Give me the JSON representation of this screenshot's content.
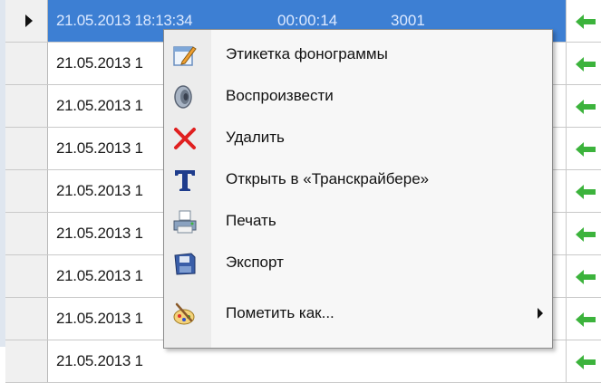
{
  "rows": [
    {
      "date": "21.05.2013 18:13:34",
      "duration": "00:00:14",
      "number": "3001",
      "selected": true
    },
    {
      "date": "21.05.2013 1"
    },
    {
      "date": "21.05.2013 1"
    },
    {
      "date": "21.05.2013 1"
    },
    {
      "date": "21.05.2013 1"
    },
    {
      "date": "21.05.2013 1"
    },
    {
      "date": "21.05.2013 1"
    },
    {
      "date": "21.05.2013 1"
    },
    {
      "date": "21.05.2013 1"
    }
  ],
  "context_menu": {
    "items": [
      {
        "label": "Этикетка фонограммы",
        "icon": "label-edit-icon"
      },
      {
        "label": "Воспроизвести",
        "icon": "speaker-icon"
      },
      {
        "label": "Удалить",
        "icon": "delete-x-icon"
      },
      {
        "label": "Открыть в «Транскрайбере»",
        "icon": "transcriber-t-icon"
      },
      {
        "label": "Печать",
        "icon": "printer-icon"
      },
      {
        "label": "Экспорт",
        "icon": "export-disk-icon"
      },
      {
        "label": "Пометить как...",
        "icon": "mark-paint-icon",
        "has_submenu": true
      }
    ]
  },
  "colors": {
    "selection": "#3d7fd3",
    "direction_arrow": "#3cb33c",
    "delete_icon": "#e02020"
  }
}
